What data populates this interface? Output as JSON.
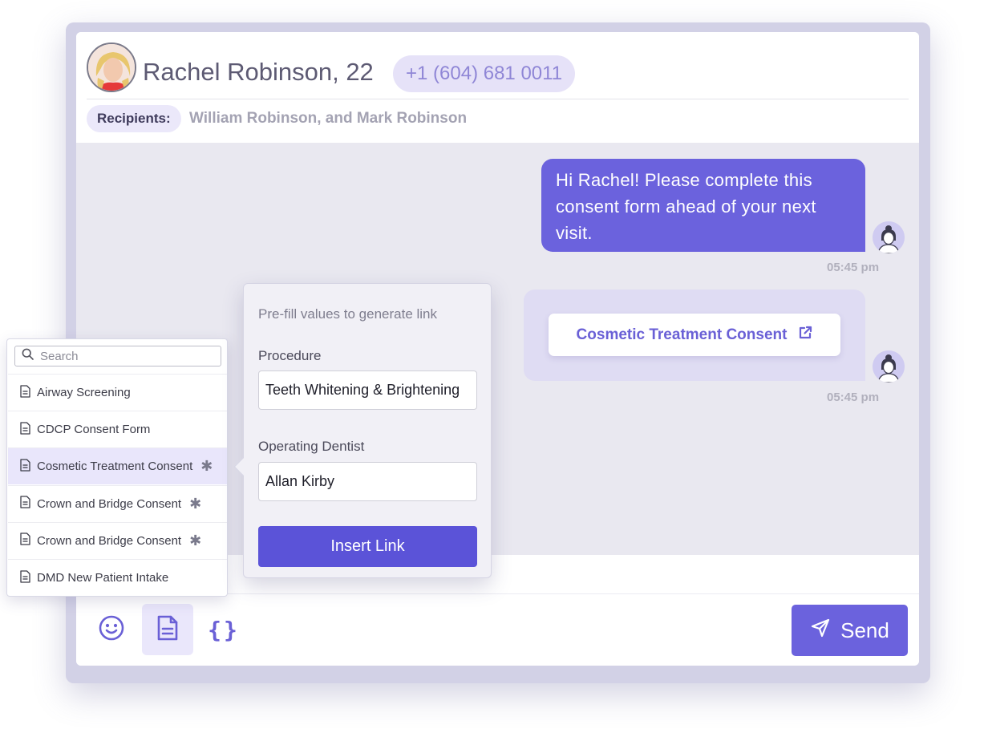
{
  "header": {
    "patient_name": "Rachel Robinson, 22",
    "phone": "+1 (604) 681 0011",
    "recipients_label": "Recipients:",
    "recipients_value": "William Robinson, and Mark Robinson"
  },
  "chat": {
    "messages": [
      {
        "text": "Hi Rachel! Please complete this consent form ahead of your next visit.",
        "time": "05:45 pm"
      },
      {
        "link_label": "Cosmetic Treatment Consent",
        "time": "05:45 pm"
      }
    ]
  },
  "form_menu": {
    "search_placeholder": "Search",
    "items": [
      {
        "label": "Airway Screening",
        "starred": false,
        "selected": false
      },
      {
        "label": "CDCP Consent Form",
        "starred": false,
        "selected": false
      },
      {
        "label": "Cosmetic Treatment Consent",
        "starred": true,
        "selected": true
      },
      {
        "label": "Crown and Bridge Consent",
        "starred": true,
        "selected": false
      },
      {
        "label": "Crown and Bridge Consent",
        "starred": true,
        "selected": false
      },
      {
        "label": "DMD New Patient Intake",
        "starred": false,
        "selected": false
      }
    ]
  },
  "prefill": {
    "title": "Pre-fill values to generate link",
    "procedure_label": "Procedure",
    "procedure_value": "Teeth Whitening & Brightening",
    "dentist_label": "Operating Dentist",
    "dentist_value": "Allan Kirby",
    "insert_label": "Insert Link"
  },
  "compose": {
    "send_label": "Send",
    "braces_glyph": "{}"
  },
  "colors": {
    "accent": "#6b62dd",
    "accent_light": "#eae7fb",
    "chat_bg": "#e9e8f0"
  },
  "icons": [
    "emoji-icon",
    "document-icon",
    "braces-icon",
    "send-icon",
    "external-link-icon",
    "search-icon",
    "file-icon",
    "star-icon"
  ]
}
